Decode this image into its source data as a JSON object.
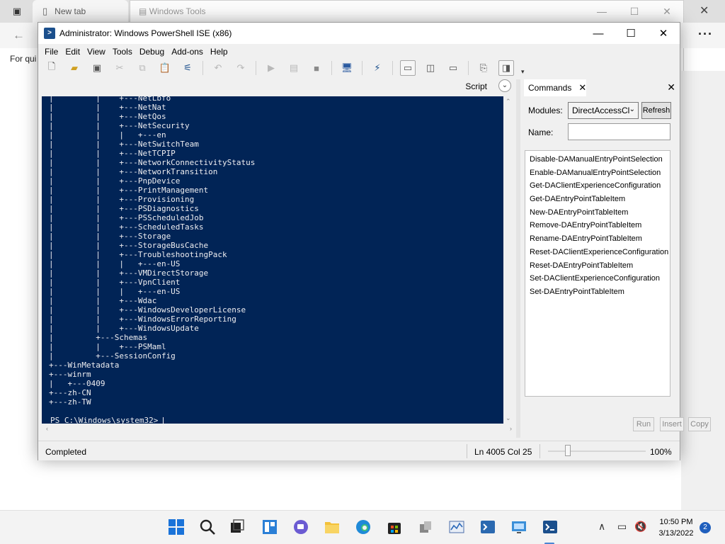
{
  "browser": {
    "tab_active": "New tab",
    "tab_other": "Windows Tools",
    "quick_links_label": "For qui",
    "more_label": "···"
  },
  "ise": {
    "title": "Administrator: Windows PowerShell ISE (x86)",
    "menu": [
      "File",
      "Edit",
      "View",
      "Tools",
      "Debug",
      "Add-ons",
      "Help"
    ],
    "script_label": "Script",
    "console_lines": [
      "|         |    +---NetLbfo",
      "|         |    +---NetNat",
      "|         |    +---NetQos",
      "|         |    +---NetSecurity",
      "|         |    |   +---en",
      "|         |    +---NetSwitchTeam",
      "|         |    +---NetTCPIP",
      "|         |    +---NetworkConnectivityStatus",
      "|         |    +---NetworkTransition",
      "|         |    +---PnpDevice",
      "|         |    +---PrintManagement",
      "|         |    +---Provisioning",
      "|         |    +---PSDiagnostics",
      "|         |    +---PSScheduledJob",
      "|         |    +---ScheduledTasks",
      "|         |    +---Storage",
      "|         |    +---StorageBusCache",
      "|         |    +---TroubleshootingPack",
      "|         |    |   +---en-US",
      "|         |    +---VMDirectStorage",
      "|         |    +---VpnClient",
      "|         |    |   +---en-US",
      "|         |    +---Wdac",
      "|         |    +---WindowsDeveloperLicense",
      "|         |    +---WindowsErrorReporting",
      "|         |    +---WindowsUpdate",
      "|         +---Schemas",
      "|         |    +---PSMaml",
      "|         +---SessionConfig",
      "+---WinMetadata",
      "+---winrm",
      "|   +---0409",
      "+---zh-CN",
      "+---zh-TW"
    ],
    "prompt": "PS C:\\Windows\\system32> ",
    "status": {
      "text": "Completed",
      "position": "Ln 4005  Col 25",
      "zoom": "100%",
      "zoom_level": 1.0
    }
  },
  "commands": {
    "tab_label": "Commands",
    "modules_label": "Modules:",
    "modules_value": "DirectAccessCl",
    "refresh_label": "Refresh",
    "name_label": "Name:",
    "name_value": "",
    "items": [
      "Disable-DAManualEntryPointSelection",
      "Enable-DAManualEntryPointSelection",
      "Get-DAClientExperienceConfiguration",
      "Get-DAEntryPointTableItem",
      "New-DAEntryPointTableItem",
      "Remove-DAEntryPointTableItem",
      "Rename-DAEntryPointTableItem",
      "Reset-DAClientExperienceConfiguration",
      "Reset-DAEntryPointTableItem",
      "Set-DAClientExperienceConfiguration",
      "Set-DAEntryPointTableItem"
    ],
    "run_label": "Run",
    "insert_label": "Insert",
    "copy_label": "Copy"
  },
  "taskbar": {
    "time": "10:50 PM",
    "date": "3/13/2022",
    "notifications": "2",
    "apps": [
      "start-icon",
      "search-icon",
      "task-view-icon",
      "widgets-icon",
      "chat-icon",
      "file-explorer-icon",
      "edge-icon",
      "store-icon",
      "server-manager-icon",
      "performance-monitor-icon",
      "powershell-icon",
      "remote-desktop-icon",
      "powershell-ise-icon"
    ]
  },
  "colors": {
    "console_bg": "#012456",
    "console_fg": "#eeedf0",
    "accent": "#1f5fbd"
  }
}
